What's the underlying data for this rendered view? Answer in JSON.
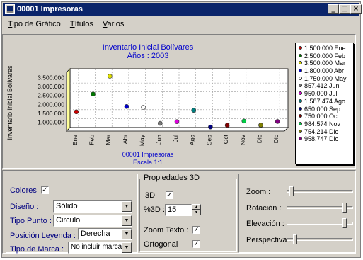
{
  "window": {
    "title": "00001 Impresoras"
  },
  "window_buttons": {
    "minimize": "_",
    "maximize": "□",
    "close": "×"
  },
  "menu": [
    "Tipo de Gráfico",
    "Títulos",
    "Varios"
  ],
  "chart_data": {
    "type": "scatter",
    "title": "Inventario Inicial  Bolívares",
    "subtitle": "Años : 2003",
    "ylabel": "Inventario Inicial Bolívares",
    "footer": [
      "00001 Impresoras",
      "Escala 1:1"
    ],
    "categories": [
      "Ene",
      "Feb",
      "Mar",
      "Abr",
      "May",
      "Jun",
      "Jul",
      "Ago",
      "Sep",
      "Oct",
      "Nov",
      "Dic",
      "Dic"
    ],
    "values": [
      1500000,
      2500000,
      3500000,
      1800000,
      1750000,
      857412,
      950000,
      1587474,
      650000,
      750000,
      984574,
      754214,
      958747
    ],
    "yticks": [
      "1.000.000",
      "1.500.000",
      "2.000.000",
      "2.500.000",
      "3.000.000",
      "3.500.000"
    ],
    "ytick_values": [
      1000000,
      1500000,
      2000000,
      2500000,
      3000000,
      3500000
    ],
    "ylim": [
      500000,
      3800000
    ],
    "view3d": true,
    "grid": true,
    "legend_position": "right",
    "colors": [
      "#cc0000",
      "#007700",
      "#dddd00",
      "#0000cc",
      "#ffffff",
      "#777777",
      "#dd00dd",
      "#008080",
      "#000080",
      "#800000",
      "#00cc44",
      "#808000",
      "#800080"
    ],
    "legend": [
      "1.500.000 Ene",
      "2.500.000 Feb",
      "3.500.000 Mar",
      "1.800.000 Abr",
      "1.750.000 May",
      "857.412 Jun",
      "950.000 Jul",
      "1.587.474 Ago",
      "650.000 Sep",
      "750.000 Oct",
      "984.574 Nov",
      "754.214 Dic",
      "958.747 Dic"
    ]
  },
  "options": {
    "colores_label": "Colores",
    "colores_checked": "✓",
    "diseno_label": "Diseño :",
    "diseno_value": "Sólido",
    "tipo_punto_label": "Tipo Punto :",
    "tipo_punto_value": "Circulo",
    "posicion_leyenda_label": "Posición Leyenda :",
    "posicion_leyenda_value": "Derecha",
    "tipo_marca_label": "Tipo de Marca :",
    "tipo_marca_value": "No incluir marcas"
  },
  "props3d": {
    "title": "Propiedades 3D",
    "label_3d": "3D",
    "check_3d": "✓",
    "percent_label": "%3D :",
    "percent_value": "15",
    "zoom_texto_label": "Zoom Texto :",
    "zoom_texto_check": "✓",
    "ortogonal_label": "Ortogonal",
    "ortogonal_check": "✓"
  },
  "sliders": {
    "zoom_label": "Zoom :",
    "zoom_level": 0.05,
    "rotacion_label": "Rotación :",
    "rotacion_level": 0.9,
    "elevacion_label": "Elevación :",
    "elevacion_level": 0.9,
    "perspectiva_label": "Perspectiva :",
    "perspectiva_level": 0.1
  }
}
